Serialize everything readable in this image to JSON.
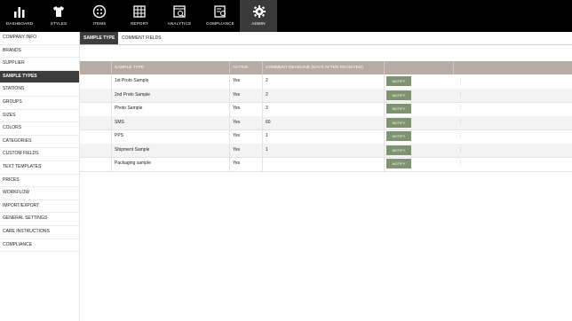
{
  "topnav": {
    "items": [
      {
        "label": "DASHBOARD",
        "icon": "bar-chart-icon"
      },
      {
        "label": "STYLES",
        "icon": "shirt-icon"
      },
      {
        "label": "ITEMS",
        "icon": "button-icon"
      },
      {
        "label": "REPORT",
        "icon": "grid-icon"
      },
      {
        "label": "ANALYTICS",
        "icon": "analytics-icon"
      },
      {
        "label": "COMPLIANCE",
        "icon": "compliance-icon"
      },
      {
        "label": "ADMIN",
        "icon": "gear-icon"
      }
    ]
  },
  "sidebar": {
    "items": [
      {
        "label": "COMPANY INFO"
      },
      {
        "label": "BRANDS"
      },
      {
        "label": "SUPPLIER"
      },
      {
        "label": "SAMPLE TYPES"
      },
      {
        "label": "STATIONS"
      },
      {
        "label": "GROUPS"
      },
      {
        "label": "SIZES"
      },
      {
        "label": "COLORS"
      },
      {
        "label": "CATEGORIES"
      },
      {
        "label": "CUSTOM FIELDS"
      },
      {
        "label": "TEXT TEMPLATES"
      },
      {
        "label": "PRICES"
      },
      {
        "label": "WORKFLOW"
      },
      {
        "label": "IMPORT/EXPORT"
      },
      {
        "label": "GENERAL SETTINGS"
      },
      {
        "label": "CARE INSTRUCTIONS"
      },
      {
        "label": "COMPLIANCE"
      }
    ]
  },
  "tabs": {
    "sample_type": "SAMPLE TYPE",
    "comment_fields": "COMMENT FIELDS"
  },
  "table": {
    "headers": {
      "sample_type": "SAMPLE TYPE",
      "active": "ACTIVE",
      "deadline": "COMMENT DEADLINE (DAYS AFTER RECEIVED)"
    },
    "notify_label": "NOTIFY",
    "more_glyph": "⋮",
    "rows": [
      {
        "name": "1st Proto Sample",
        "active": "Yes",
        "deadline": "2"
      },
      {
        "name": "2nd Proto Sample",
        "active": "Yes",
        "deadline": "2"
      },
      {
        "name": "Photo Sample",
        "active": "Yes",
        "deadline": "3"
      },
      {
        "name": "SMS",
        "active": "Yes",
        "deadline": "60"
      },
      {
        "name": "PPS",
        "active": "Yes",
        "deadline": "1"
      },
      {
        "name": "Shipment Sample",
        "active": "Yes",
        "deadline": "1"
      },
      {
        "name": "Packaging sample",
        "active": "Yes",
        "deadline": ""
      }
    ]
  },
  "colors": {
    "topbar": "#000000",
    "header": "#b6aca4",
    "notify": "#7e9471",
    "active_sidebar": "#3d3d3d"
  }
}
